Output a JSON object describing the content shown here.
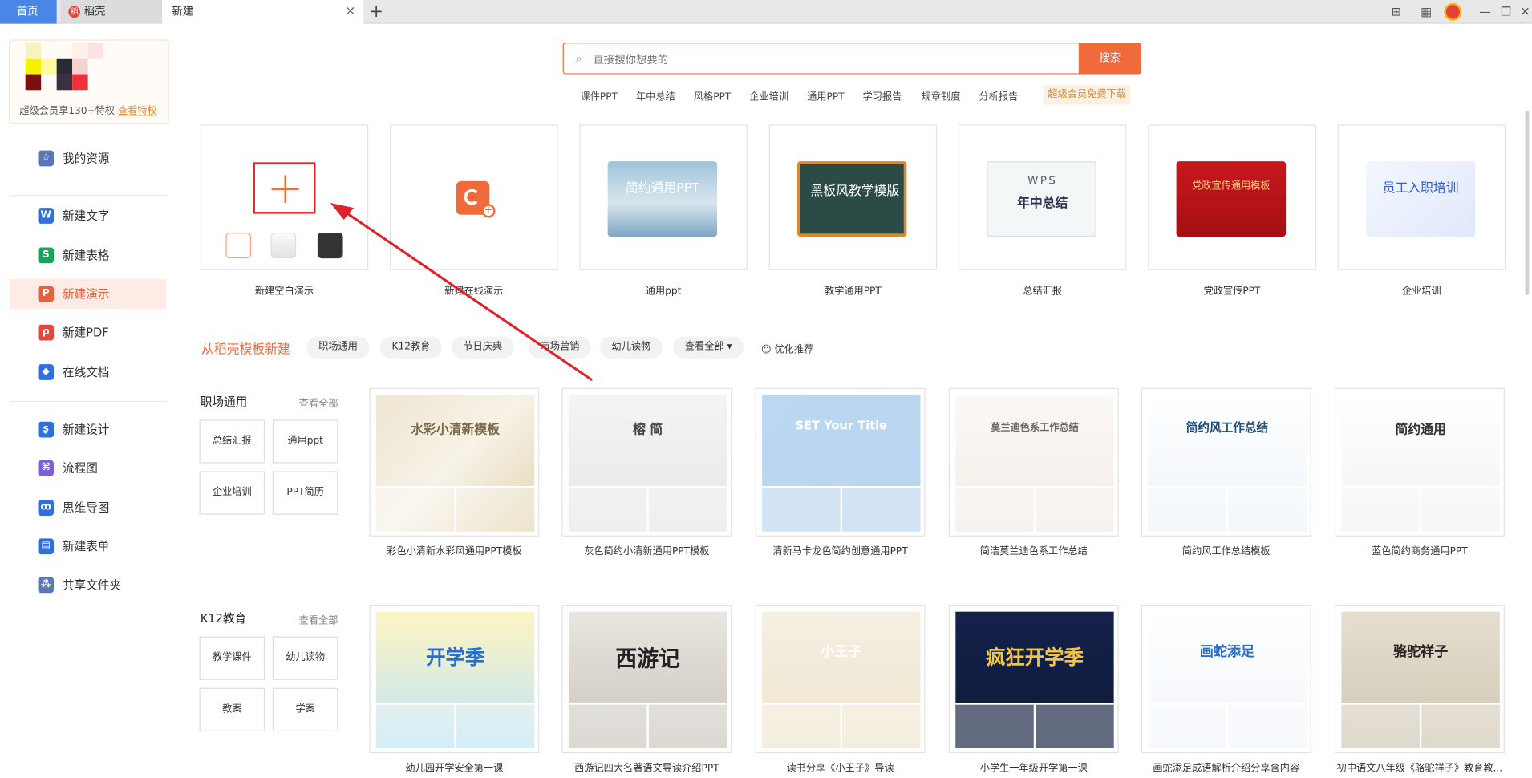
{
  "tabs": {
    "home": "首页",
    "daoke": "稻壳",
    "daoke_logo": "稻",
    "current": "新建",
    "close": "×",
    "add": "+"
  },
  "window": {
    "minimize": "—",
    "restore": "❐",
    "close": "✕",
    "layout": "⊞",
    "grid": "▦"
  },
  "sidebar": {
    "promo_text": "超级会员享130+特权",
    "promo_link": "查看特权",
    "items": [
      {
        "label": "我的资源",
        "icon": "star-icon",
        "glyph": "☆",
        "color": "#5a78b8"
      },
      {
        "label": "新建文字",
        "icon": "word-icon",
        "glyph": "W",
        "color": "#2f6fde"
      },
      {
        "label": "新建表格",
        "icon": "sheet-icon",
        "glyph": "S",
        "color": "#1aa260"
      },
      {
        "label": "新建演示",
        "icon": "presentation-icon",
        "glyph": "P",
        "color": "#e8613e"
      },
      {
        "label": "新建PDF",
        "icon": "pdf-icon",
        "glyph": "ρ",
        "color": "#e2483f"
      },
      {
        "label": "在线文档",
        "icon": "cloud-doc-icon",
        "glyph": "◆",
        "color": "#2f6fde"
      },
      {
        "label": "新建设计",
        "icon": "design-icon",
        "glyph": "ʂ",
        "color": "#2f6fde"
      },
      {
        "label": "流程图",
        "icon": "flowchart-icon",
        "glyph": "⌘",
        "color": "#7b61d9"
      },
      {
        "label": "思维导图",
        "icon": "mindmap-icon",
        "glyph": "ꝏ",
        "color": "#2f6fde"
      },
      {
        "label": "新建表单",
        "icon": "form-icon",
        "glyph": "▤",
        "color": "#2f6fde"
      },
      {
        "label": "共享文件夹",
        "icon": "share-folder-icon",
        "glyph": "⁂",
        "color": "#5a78b8"
      }
    ]
  },
  "search": {
    "placeholder": "直接搜你想要的",
    "button": "搜索",
    "icon": "search-icon"
  },
  "hotwords": [
    "课件PPT",
    "年中总结",
    "风格PPT",
    "企业培训",
    "通用PPT",
    "学习报告",
    "规章制度",
    "分析报告"
  ],
  "vip_download": "超级会员免费下载",
  "top_cards": [
    {
      "label": "新建空白演示"
    },
    {
      "label": "新建在线演示"
    },
    {
      "label": "通用ppt",
      "thumb_text": "简约通用PPT"
    },
    {
      "label": "教学通用PPT",
      "thumb_text": "黑板风教学模版"
    },
    {
      "label": "总结汇报",
      "thumb_text": "年中总结",
      "thumb_sub": "WPS"
    },
    {
      "label": "党政宣传PPT",
      "thumb_text": "党政宣传通用模板"
    },
    {
      "label": "企业培训",
      "thumb_text": "员工入职培训"
    }
  ],
  "template_section": {
    "title": "从稻壳模板新建",
    "chips": [
      "职场通用",
      "K12教育",
      "节日庆典",
      "市场营销",
      "幼儿读物",
      "查看全部 ▾"
    ],
    "optimize": "☺ 优化推荐"
  },
  "categories": [
    {
      "title": "职场通用",
      "more": "查看全部",
      "buttons": [
        "总结汇报",
        "通用ppt",
        "企业培训",
        "PPT简历"
      ],
      "templates": [
        {
          "label": "彩色小清新水彩风通用PPT模板",
          "art_text": "水彩小清新模板"
        },
        {
          "label": "灰色简约小清新通用PPT模板",
          "art_text": "榕 简"
        },
        {
          "label": "清新马卡龙色简约创意通用PPT",
          "art_text": "SET Your Title"
        },
        {
          "label": "简洁莫兰迪色系工作总结",
          "art_text": "莫兰迪色系工作总结"
        },
        {
          "label": "简约风工作总结模板",
          "art_text": "简约风工作总结"
        },
        {
          "label": "蓝色简约商务通用PPT",
          "art_text": "简约通用"
        }
      ]
    },
    {
      "title": "K12教育",
      "more": "查看全部",
      "buttons": [
        "教学课件",
        "幼儿读物",
        "教案",
        "学案"
      ],
      "templates": [
        {
          "label": "幼儿园开学安全第一课",
          "art_text": "开学季"
        },
        {
          "label": "西游记四大名著语文导读介绍PPT",
          "art_text": "西游记"
        },
        {
          "label": "读书分享《小王子》导读",
          "art_text": "小王子"
        },
        {
          "label": "小学生一年级开学第一课",
          "art_text": "疯狂开学季"
        },
        {
          "label": "画蛇添足成语解析介绍分享含内容",
          "art_text": "画蛇添足"
        },
        {
          "label": "初中语文八年级《骆驼祥子》教育教...",
          "art_text": "骆驼祥子"
        }
      ]
    }
  ],
  "colors": {
    "accent": "#f06a3b",
    "blue": "#4a86e8",
    "active_bg": "#fdece6",
    "arrow": "#e0212a"
  }
}
